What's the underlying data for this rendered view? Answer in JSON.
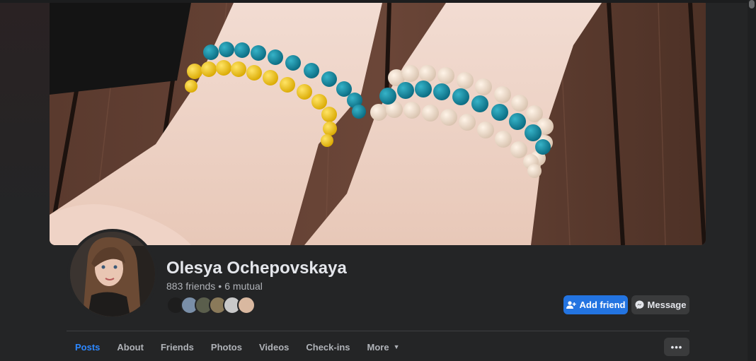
{
  "profile": {
    "name": "Olesya Ochepovskaya",
    "friends": "883 friends",
    "separator": "•",
    "mutual": "6 mutual"
  },
  "mutual_friends": [
    {
      "icon": "avatar-1",
      "color": "#1d1d1d"
    },
    {
      "icon": "avatar-2",
      "color": "#7a8fa8"
    },
    {
      "icon": "avatar-3",
      "color": "#5a5e4c"
    },
    {
      "icon": "avatar-4",
      "color": "#8a7a5a"
    },
    {
      "icon": "avatar-5",
      "color": "#c9c9c9"
    },
    {
      "icon": "avatar-6",
      "color": "#d9b8a0"
    }
  ],
  "actions": {
    "add_friend": "Add friend",
    "message": "Message",
    "more_options_icon": "•••"
  },
  "tabs": [
    {
      "label": "Posts",
      "active": true
    },
    {
      "label": "About"
    },
    {
      "label": "Friends"
    },
    {
      "label": "Photos"
    },
    {
      "label": "Videos"
    },
    {
      "label": "Check-ins"
    },
    {
      "label": "More"
    }
  ],
  "colors": {
    "accent": "#2374e1",
    "active_tab": "#2d88ff",
    "background": "#242526"
  }
}
